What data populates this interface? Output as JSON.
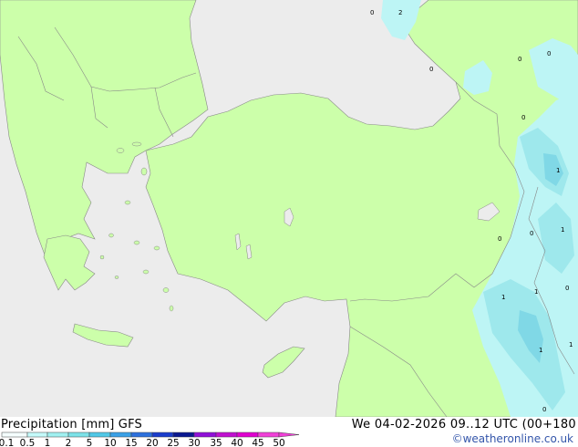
{
  "footer": {
    "title": "Precipitation [mm]  GFS",
    "datetime": "We 04-02-2026 09..12 UTC (00+180",
    "credit": "©weatheronline.co.uk"
  },
  "legend": {
    "ticks": [
      "0.1",
      "0.5",
      "1",
      "2",
      "5",
      "10",
      "15",
      "20",
      "25",
      "30",
      "35",
      "40",
      "45",
      "50"
    ],
    "colors": [
      "#f5fefe",
      "#c4fafa",
      "#a0f0f0",
      "#7ce2e8",
      "#50c8e6",
      "#3aa0e6",
      "#2c70dd",
      "#1a3ccc",
      "#0a1890",
      "#9010d8",
      "#c010d0",
      "#e000d0",
      "#f040d8"
    ]
  },
  "colors": {
    "sea": "#ececec",
    "land": "#ccffaa",
    "precip_light": "#bdf5f5",
    "precip_medium": "#9ee8ec",
    "precip_heavy": "#80d8e6",
    "border": "#888888"
  },
  "map_labels": [
    "0",
    "2",
    "0",
    "0",
    "0",
    "0",
    "1",
    "1",
    "0",
    "0",
    "1",
    "1",
    "0",
    "1",
    "1",
    "0"
  ]
}
